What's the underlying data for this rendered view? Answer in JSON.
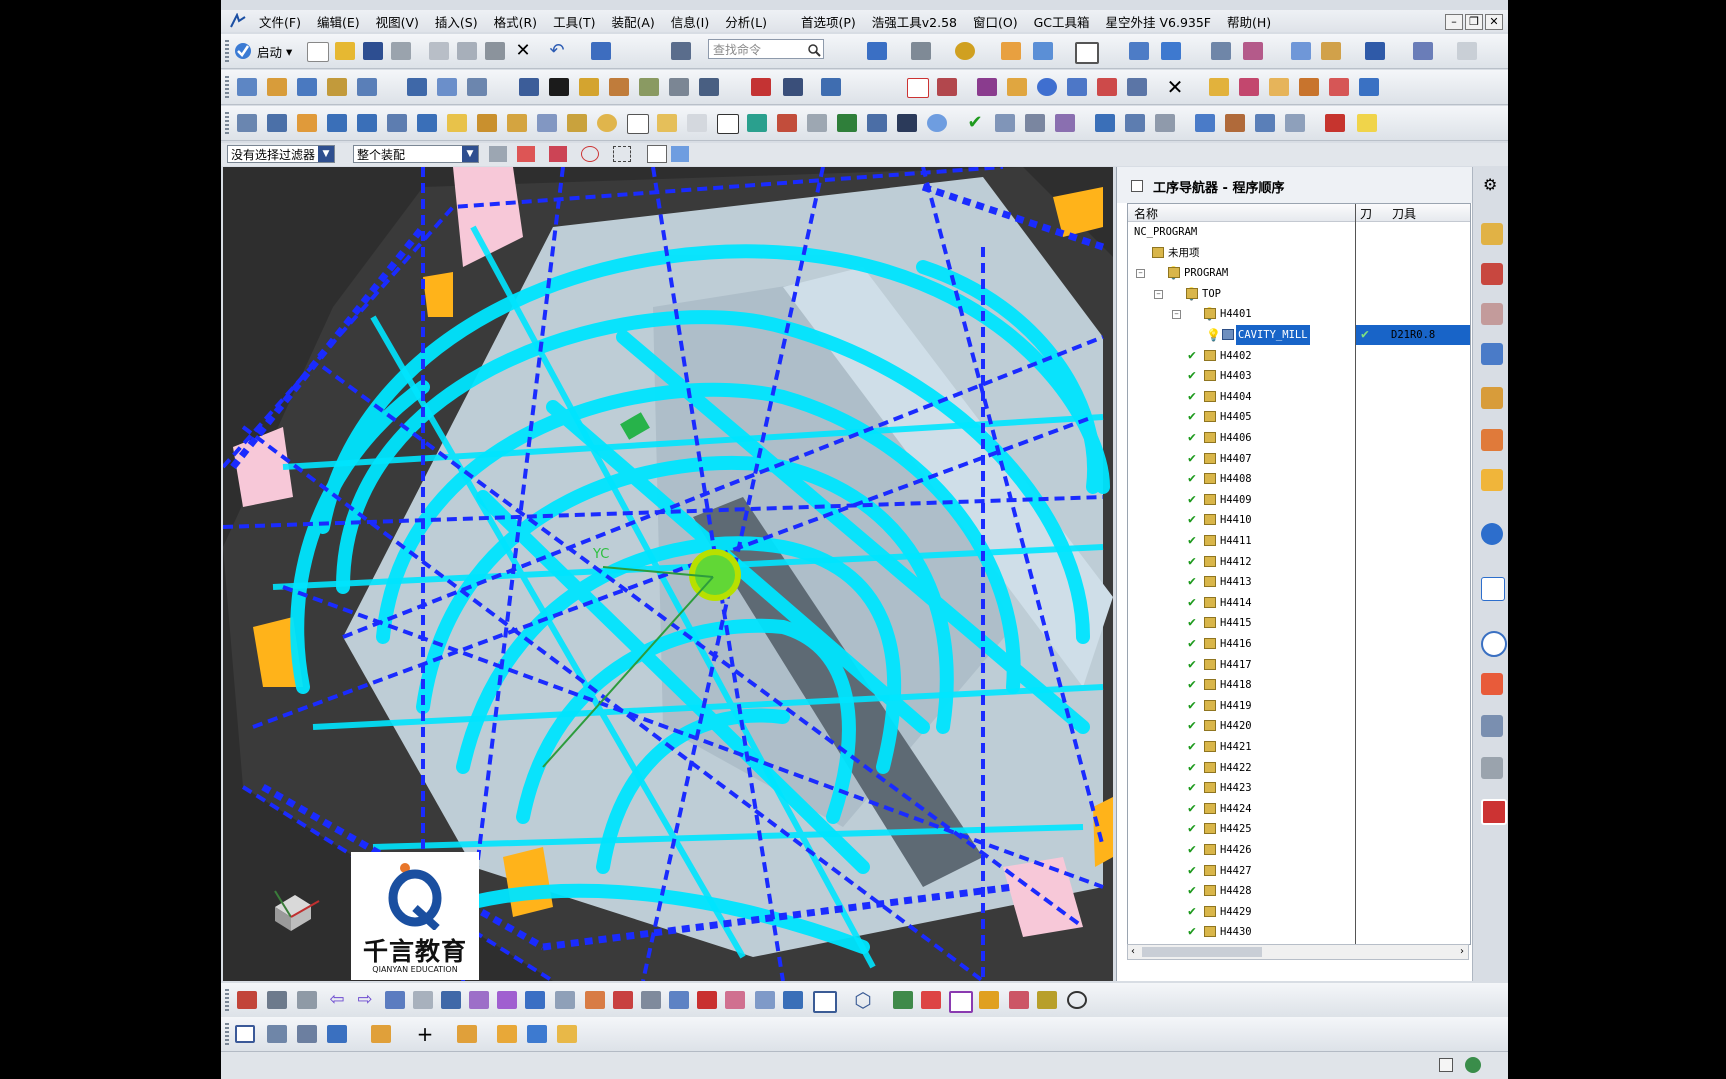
{
  "menubar": {
    "items": [
      "文件(F)",
      "编辑(E)",
      "视图(V)",
      "插入(S)",
      "格式(R)",
      "工具(T)",
      "装配(A)",
      "信息(I)",
      "分析(L)",
      "首选项(P)",
      "浩强工具v2.58",
      "窗口(O)",
      "GC工具箱",
      "星空外挂 V6.935F",
      "帮助(H)"
    ]
  },
  "toolbar": {
    "startup_label": "启动",
    "search_placeholder": "查找命令"
  },
  "filterbar": {
    "selection_filter": "没有选择过滤器",
    "scope": "整个装配"
  },
  "navigator": {
    "title": "工序导航器 - 程序顺序",
    "columns": {
      "name": "名称",
      "path": "刀",
      "tool": "刀具"
    },
    "root": "NC_PROGRAM",
    "unused": "未用项",
    "program": "PROGRAM",
    "top": "TOP",
    "group_open": "H4401",
    "selected_op": {
      "name": "CAVITY_MILL",
      "tool": "D21R0.8"
    },
    "groups": [
      "H4402",
      "H4403",
      "H4404",
      "H4405",
      "H4406",
      "H4407",
      "H4408",
      "H4409",
      "H4410",
      "H4411",
      "H4412",
      "H4413",
      "H4414",
      "H4415",
      "H4416",
      "H4417",
      "H4418",
      "H4419",
      "H4420",
      "H4421",
      "H4422",
      "H4423",
      "H4424",
      "H4425",
      "H4426",
      "H4427",
      "H4428",
      "H4429",
      "H4430"
    ]
  },
  "viewport": {
    "axis_label": "YC",
    "watermark_cn": "千言教育",
    "watermark_en": "QIANYAN EDUCATION",
    "toolpath_color": "#00e5ff",
    "rapid_color": "#1a2bff"
  }
}
